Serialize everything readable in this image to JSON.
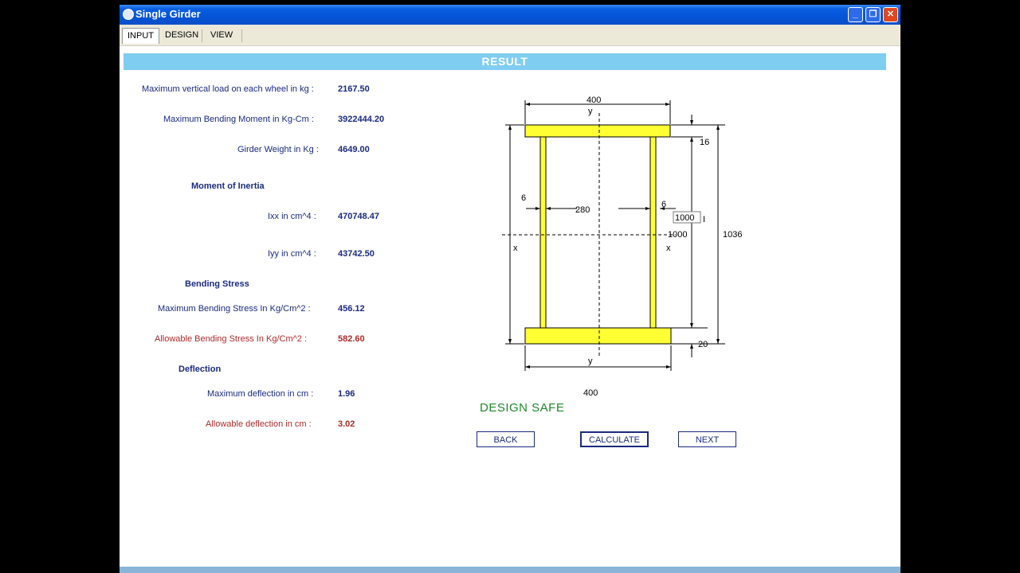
{
  "window": {
    "title": "Single Girder"
  },
  "tabs": [
    "INPUT",
    "DESIGN",
    "VIEW"
  ],
  "banner": "RESULT",
  "results": {
    "max_wheel_load_label": "Maximum vertical load on each wheel in kg :",
    "max_wheel_load_value": "2167.50",
    "max_bm_label": "Maximum Bending Moment in Kg-Cm :",
    "max_bm_value": "3922444.20",
    "girder_weight_label": "Girder Weight in Kg :",
    "girder_weight_value": "4649.00",
    "moi_heading": "Moment of Inertia",
    "ixx_label": "Ixx  in cm^4 :",
    "ixx_value": "470748.47",
    "iyy_label": "Iyy in cm^4 :",
    "iyy_value": "43742.50",
    "bending_heading": "Bending Stress",
    "max_bs_label": "Maximum Bending Stress In Kg/Cm^2 :",
    "max_bs_value": "456.12",
    "allow_bs_label": "Allowable Bending Stress  In Kg/Cm^2 :",
    "allow_bs_value": "582.60",
    "deflection_heading": "Deflection",
    "max_def_label": "Maximum deflection in cm :",
    "max_def_value": "1.96",
    "allow_def_label": "Allowable deflection in cm :",
    "allow_def_value": "3.02"
  },
  "drawing": {
    "top_width": "400",
    "bottom_width": "400",
    "top_flange_thk": "16",
    "bottom_flange_thk": "20",
    "web_thk_left": "6",
    "web_thk_right": "6",
    "web_spacing": "280",
    "web_height_input": "1000",
    "web_height": "1000",
    "total_height": "1036",
    "axis_y": "y",
    "axis_x": "x"
  },
  "status": "DESIGN SAFE",
  "buttons": {
    "back": "BACK",
    "calculate": "CALCULATE",
    "next": "NEXT"
  },
  "colors": {
    "flange": "#ffff33",
    "banner": "#80cdf2",
    "safe": "#1c8a2a",
    "label": "#1a2a80",
    "alert": "#b02a2a"
  }
}
